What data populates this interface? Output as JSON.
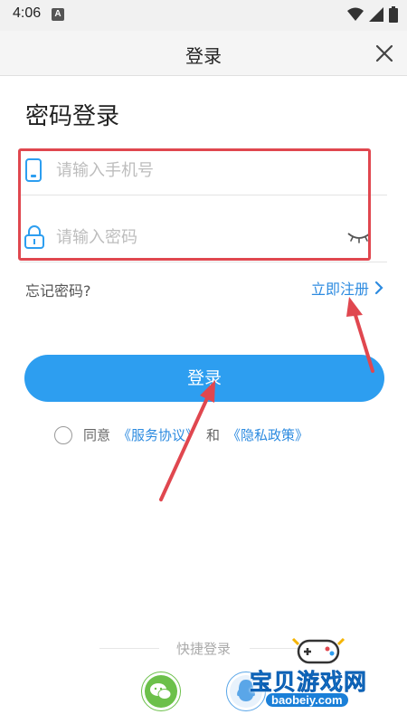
{
  "status": {
    "time": "4:06",
    "badge": "A"
  },
  "title": "登录",
  "heading": "密码登录",
  "phone": {
    "placeholder": "请输入手机号",
    "value": ""
  },
  "password": {
    "placeholder": "请输入密码",
    "value": ""
  },
  "forgot": "忘记密码?",
  "register": "立即注册",
  "login_button": "登录",
  "agreement": {
    "prefix": "同意",
    "service": "《服务协议》",
    "and": "和",
    "privacy": "《隐私政策》"
  },
  "quick_login": "快捷登录",
  "watermark": {
    "name": "宝贝游戏网",
    "url": "baobeiy.com"
  },
  "colors": {
    "accent": "#2d9ef0",
    "link": "#2d8be0",
    "highlight": "#e0474f",
    "wechat": "#6cc04a",
    "qq": "#5aa6e8"
  }
}
